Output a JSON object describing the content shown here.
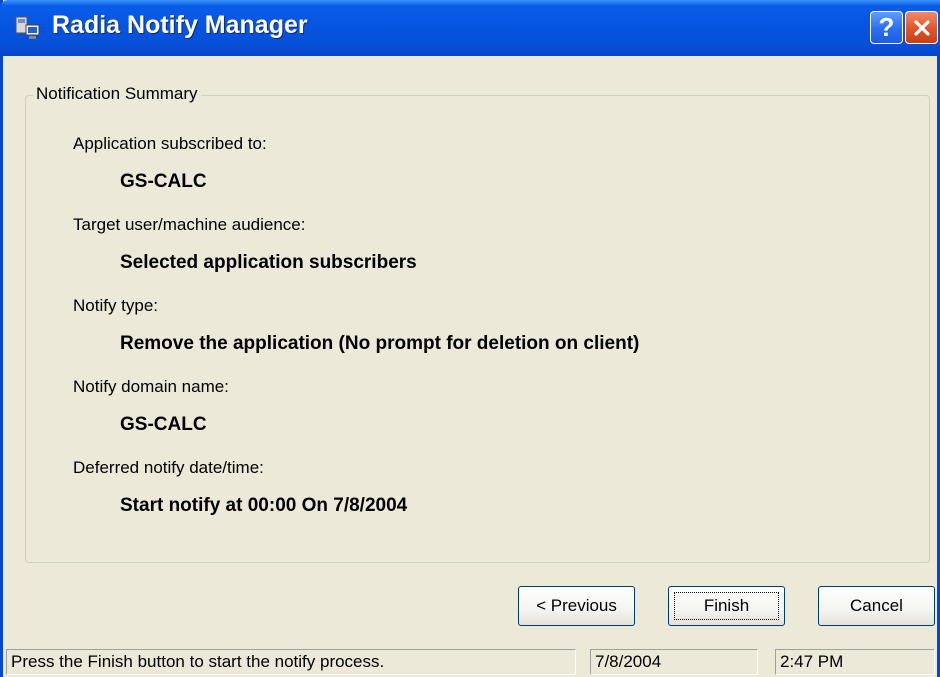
{
  "window": {
    "title": "Radia Notify Manager",
    "icon": "radia-app-icon",
    "help_icon": "help-question-icon",
    "close_icon": "close-x-icon",
    "help_label": "?"
  },
  "summary": {
    "group_title": "Notification Summary",
    "items": [
      {
        "label": "Application subscribed to:",
        "value": "GS-CALC"
      },
      {
        "label": "Target user/machine audience:",
        "value": "Selected application subscribers"
      },
      {
        "label": "Notify type:",
        "value": "Remove the application (No prompt for deletion on client)"
      },
      {
        "label": "Notify domain name:",
        "value": "GS-CALC"
      },
      {
        "label": "Deferred notify date/time:",
        "value": "Start notify at 00:00 On 7/8/2004"
      }
    ]
  },
  "buttons": {
    "previous": "< Previous",
    "finish": "Finish",
    "cancel": "Cancel"
  },
  "statusbar": {
    "message": "Press the Finish button to start the notify process.",
    "date": "7/8/2004",
    "time": "2:47 PM"
  },
  "colors": {
    "titlebar": "#0654e2",
    "window_bg": "#ece9d8",
    "close_button": "#e05a2e",
    "button_border": "#003c74"
  }
}
